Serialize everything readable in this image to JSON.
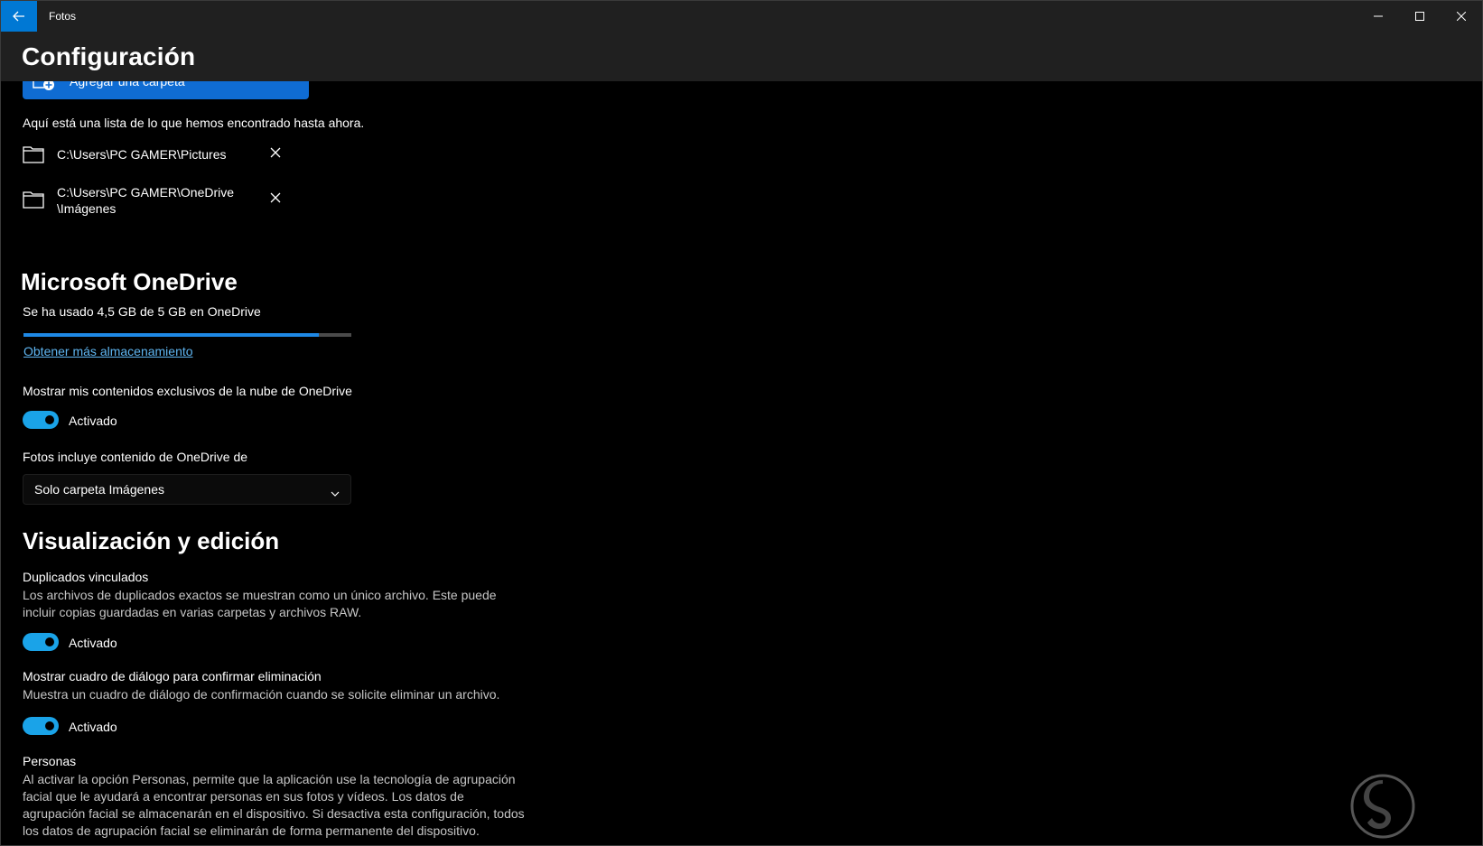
{
  "window": {
    "title": "Fotos",
    "controls": [
      "minimize-icon",
      "maximize-icon",
      "close-icon"
    ],
    "accent_color": "#0078d4"
  },
  "header": {
    "title": "Configuración"
  },
  "folders": {
    "add_button_label": "Agregar una carpeta",
    "intro": "Aquí está una lista de lo que hemos encontrado hasta ahora.",
    "items": [
      {
        "line1": "C:\\Users\\PC GAMER\\Pictures",
        "line2": ""
      },
      {
        "line1": "C:\\Users\\PC GAMER\\OneDrive",
        "line2": "\\Imágenes"
      }
    ]
  },
  "onedrive": {
    "heading": "Microsoft OneDrive",
    "usage_text": "Se ha usado 4,5 GB de 5 GB en OneDrive",
    "usage_fraction": 0.9,
    "storage_link": "Obtener más almacenamiento",
    "cloud_only_label": "Mostrar mis contenidos exclusivos de la nube de OneDrive",
    "cloud_only_state": "Activado",
    "source_label": "Fotos incluye contenido de OneDrive de",
    "source_value": "Solo carpeta Imágenes"
  },
  "viewing": {
    "heading": "Visualización y edición",
    "duplicates_title": "Duplicados vinculados",
    "duplicates_desc_1": "Los archivos de duplicados exactos se muestran como un único archivo. Este puede",
    "duplicates_desc_2": "incluir copias guardadas en varias carpetas y archivos RAW.",
    "duplicates_state": "Activado",
    "confirm_delete_title": "Mostrar cuadro de diálogo para confirmar eliminación",
    "confirm_delete_desc": "Muestra un cuadro de diálogo de confirmación cuando se solicite eliminar un archivo.",
    "confirm_delete_state": "Activado",
    "people_title": "Personas",
    "people_desc_1": "Al activar la opción Personas, permite que la aplicación use la tecnología de agrupación",
    "people_desc_2": "facial que le ayudará a encontrar personas en sus fotos y vídeos. Los datos de",
    "people_desc_3": "agrupación facial se almacenarán en el dispositivo. Si desactiva esta configuración, todos",
    "people_desc_4": "los datos de agrupación facial se eliminarán de forma permanente del dispositivo."
  }
}
